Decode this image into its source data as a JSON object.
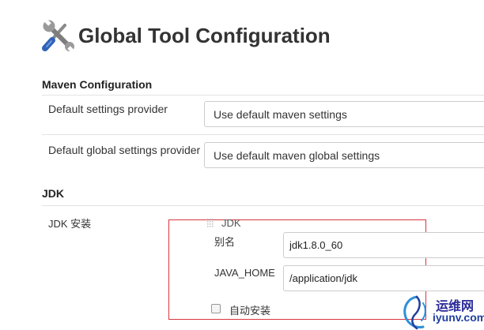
{
  "header": {
    "title": "Global Tool Configuration",
    "icon": "wrench-screwdriver-icon"
  },
  "maven": {
    "section_title": "Maven Configuration",
    "settings_label": "Default settings provider",
    "settings_value": "Use default maven settings",
    "global_settings_label": "Default global settings provider",
    "global_settings_value": "Use default maven global settings"
  },
  "jdk": {
    "section_title": "JDK",
    "install_label": "JDK 安装",
    "block_header": "JDK",
    "alias_label": "别名",
    "alias_value": "jdk1.8.0_60",
    "java_home_label": "JAVA_HOME",
    "java_home_value": "/application/jdk",
    "auto_install_label": "自动安装",
    "auto_install_checked": false
  },
  "watermark": {
    "name_cn": "运维网",
    "domain": "iyunv.com"
  },
  "colors": {
    "highlight_border": "#d9363e",
    "text": "#333333",
    "input_border": "#cccccc",
    "watermark_blue": "#1f3f9f"
  }
}
